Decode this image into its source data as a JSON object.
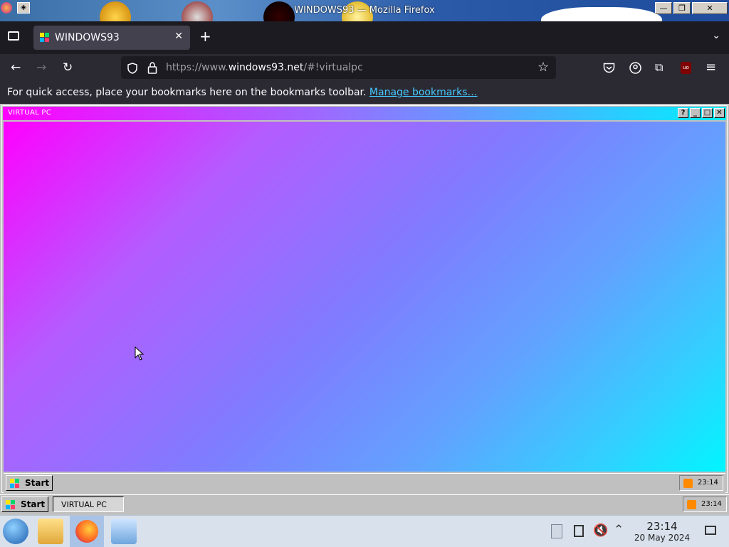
{
  "window": {
    "title": "WINDOWS93 — Mozilla Firefox",
    "minimize_glyph": "—",
    "maximize_glyph": "❐",
    "close_glyph": "✕"
  },
  "browser": {
    "tab": {
      "label": "WINDOWS93",
      "close_glyph": "✕"
    },
    "new_tab_glyph": "+",
    "list_tabs_glyph": "⌄",
    "nav": {
      "back_glyph": "←",
      "forward_glyph": "→",
      "reload_glyph": "↻"
    },
    "url": {
      "prefix": "https://www.",
      "host": "windows93.net",
      "suffix": "/#!virtualpc"
    },
    "toolbar_icons": [
      "shield-icon",
      "lock-icon",
      "star-icon",
      "pocket-icon",
      "account-icon",
      "extensions-icon",
      "ublock-icon",
      "menu-icon"
    ],
    "bookmarks": {
      "message": "For quick access, place your bookmarks here on the bookmarks toolbar. ",
      "link": "Manage bookmarks…"
    }
  },
  "windows93": {
    "virtual_pc": {
      "title": "VIRTUAL PC",
      "buttons": {
        "help": "?",
        "minimize": "_",
        "maximize": "□",
        "close": "✕"
      },
      "inner_taskbar": {
        "start_label": "Start",
        "time": "23:14"
      }
    },
    "outer_taskbar": {
      "start_label": "Start",
      "task_label": "VIRTUAL PC",
      "time": "23:14"
    }
  },
  "os_taskbar": {
    "apps": [
      "windows-start-icon",
      "file-manager-icon",
      "firefox-icon",
      "remote-desktop-icon"
    ],
    "tray": [
      "clipboard-icon",
      "device-icon",
      "volume-muted-icon",
      "show-hidden-icons-icon",
      "show-desktop-icon"
    ],
    "clock": {
      "time": "23:14",
      "date": "20 May 2024"
    }
  },
  "colors": {
    "vpc_gradient_start": "#ff00ff",
    "vpc_gradient_end": "#00f6ff",
    "firefox_bg": "#1c1b22"
  }
}
